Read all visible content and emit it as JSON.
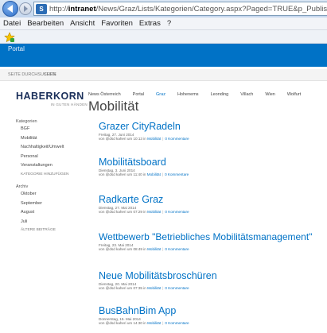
{
  "browser": {
    "url_prefix": "http://",
    "url_host": "intranet",
    "url_path": "/News/Graz/Lists/Kategorien/Category.aspx?Paged=TRUE&p_Publis",
    "menu": [
      "Datei",
      "Bearbeiten",
      "Ansicht",
      "Favoriten",
      "Extras",
      "?"
    ],
    "site_icon": "sp-icon"
  },
  "suitebar": {
    "title": "Portal"
  },
  "subbar": {
    "items": [
      "SEITE DURCHSUCHEN",
      "SEITE"
    ]
  },
  "logo": {
    "main": "HABERKORN",
    "sub": "IN GUTEN HÄNDEN"
  },
  "topnav": {
    "items": [
      "News Österreich",
      "Portal",
      "Graz",
      "Hohenems",
      "Leonding",
      "Villach",
      "Wien",
      "Wolfurt"
    ],
    "active_index": 2
  },
  "page": {
    "title": "Mobilität"
  },
  "leftnav": {
    "categories_heading": "Kategorien",
    "categories": [
      "BGF",
      "Mobilität",
      "Nachhaltigkeit/Umwelt",
      "Personal",
      "Veranstaltungen"
    ],
    "categories_manage": "KATEGORIE HINZUFÜGEN",
    "archive_heading": "Archiv",
    "archive": [
      "Oktober",
      "September",
      "August",
      "Juli"
    ],
    "archive_older": "ÄLTERE BEITRÄGE"
  },
  "posts": [
    {
      "title": "Grazer CityRadeln",
      "date": "Freitag, 27. Juni 2014",
      "meta_prefix": "von @dsd kaheri um 10:13 in",
      "category": "Mobilität",
      "comments": "0 Kommentare"
    },
    {
      "title": "Mobilitätsboard",
      "date": "Dienstag, 3. Juni 2014",
      "meta_prefix": "von @dsd kaheri um 11:40 in",
      "category": "Mobilität",
      "comments": "0 Kommentare"
    },
    {
      "title": "Radkarte Graz",
      "date": "Dienstag, 27. Mai 2014",
      "meta_prefix": "von @dsd kaheri um 07:29 in",
      "category": "Mobilität",
      "comments": "0 Kommentare"
    },
    {
      "title": "Wettbewerb \"Betriebliches Mobilitätsmanagement\"",
      "date": "Freitag, 23. Mai 2014",
      "meta_prefix": "von @dsd kaheri um 08:49 in",
      "category": "Mobilität",
      "comments": "0 Kommentare"
    },
    {
      "title": "Neue Mobilitätsbroschüren",
      "date": "Dienstag, 20. Mai 2014",
      "meta_prefix": "von @dsd kaheri um 07:35 in",
      "category": "Mobilität",
      "comments": "0 Kommentare"
    },
    {
      "title": "BusBahnBim App",
      "date": "Donnerstag, 15. Mai 2014",
      "meta_prefix": "von @dsd kaheri um 14:30 in",
      "category": "Mobilität",
      "comments": "0 Kommentare"
    }
  ],
  "colors": {
    "accent": "#0072c6",
    "suitebar": "#0072c6",
    "logo": "#1a2f5a"
  }
}
